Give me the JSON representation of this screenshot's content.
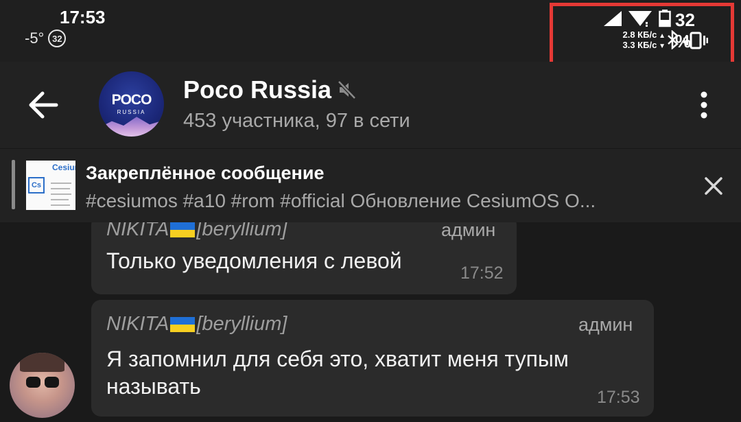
{
  "status_bar": {
    "time": "17:53",
    "temperature": "-5°",
    "aqi": "32",
    "battery_percent": "32 %",
    "upload_speed": "2.8 КБ/с",
    "download_speed": "3.3 КБ/с",
    "highlight_color": "#e53935"
  },
  "header": {
    "title": "Poco Russia",
    "subtitle": "453 участника, 97 в сети",
    "avatar_logo": "POCO",
    "avatar_sub": "RUSSIA"
  },
  "pinned": {
    "title": "Закреплённое сообщение",
    "text": "#cesiumos #a10 #rom #official  Обновление CesiumOS O...",
    "thumb_title": "Cesium",
    "thumb_badge": "Cs"
  },
  "messages": [
    {
      "sender": "NIKITA",
      "sender_tag": "[beryllium]",
      "role": "админ",
      "text": "Только уведомления с левой",
      "time": "17:52"
    },
    {
      "sender": "NIKITA",
      "sender_tag": "[beryllium]",
      "role": "админ",
      "text_line1": "Я запомнил для себя это, хватит меня тупым",
      "text_line2": "называть",
      "time": "17:53"
    }
  ]
}
